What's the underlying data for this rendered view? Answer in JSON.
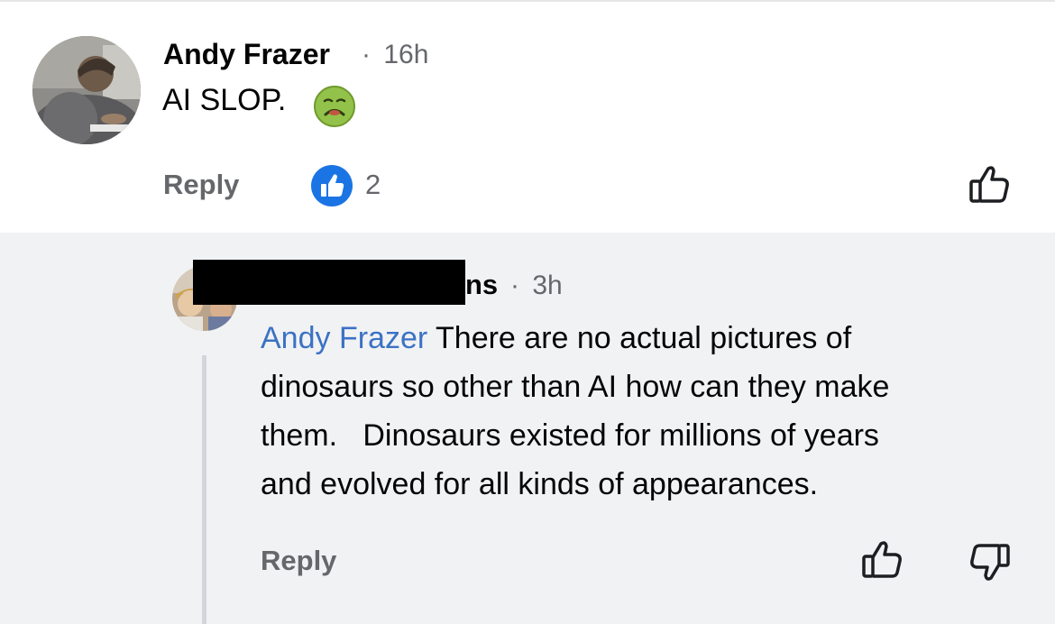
{
  "comment": {
    "author": "Andy Frazer",
    "separator": "·",
    "time": "16h",
    "text": "AI SLOP.",
    "emoji": "nauseated-face-emoji",
    "reply_label": "Reply",
    "reaction_count": "2",
    "reaction_icon": "like-reaction-icon",
    "like_icon": "thumbs-up-icon"
  },
  "reply": {
    "author_visible_suffix": "ns",
    "separator": "·",
    "time": "3h",
    "mention": "Andy Frazer",
    "text_lines": [
      " There are no actual pictures of",
      "dinosaurs so other than AI how can they make",
      "them.   Dinosaurs existed for millions of years",
      "and evolved for all kinds of appearances."
    ],
    "reply_label": "Reply",
    "like_icon": "thumbs-up-icon",
    "dislike_icon": "thumbs-down-icon"
  },
  "colors": {
    "link_blue": "#3b72c4",
    "reaction_blue": "#1b74e4",
    "meta_gray": "#65676b",
    "reply_background": "#f1f2f4",
    "thread_line": "#d3d5da"
  }
}
